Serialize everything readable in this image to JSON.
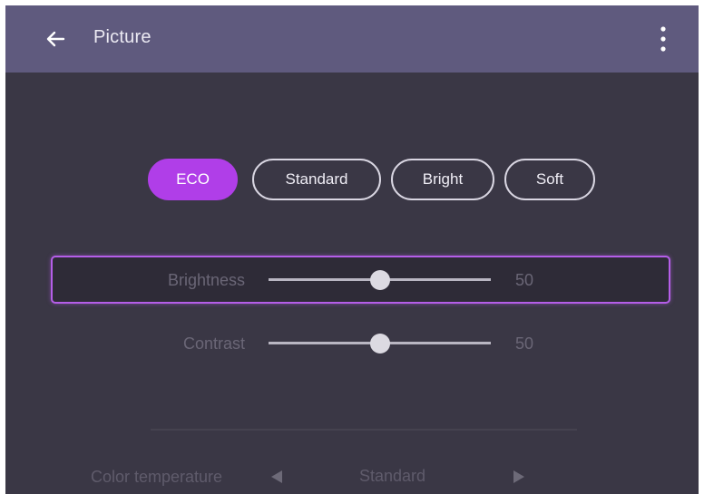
{
  "header": {
    "title": "Picture"
  },
  "modes": [
    {
      "label": "ECO",
      "active": true
    },
    {
      "label": "Standard",
      "active": false
    },
    {
      "label": "Bright",
      "active": false
    },
    {
      "label": "Soft",
      "active": false
    }
  ],
  "sliders": [
    {
      "label": "Brightness",
      "value": "50",
      "level": 50,
      "focused": true
    },
    {
      "label": "Contrast",
      "value": "50",
      "level": 50,
      "focused": false
    }
  ],
  "color_temperature": {
    "label": "Color temperature",
    "value": "Standard"
  },
  "colors": {
    "accent": "#b03ee8",
    "header_bg": "#5f5a7e",
    "screen_bg": "#3a3745",
    "focus_border": "#b55ee8"
  },
  "icons": {
    "back": "arrow-left",
    "menu": "more-vertical",
    "prev": "triangle-left",
    "next": "triangle-right"
  }
}
